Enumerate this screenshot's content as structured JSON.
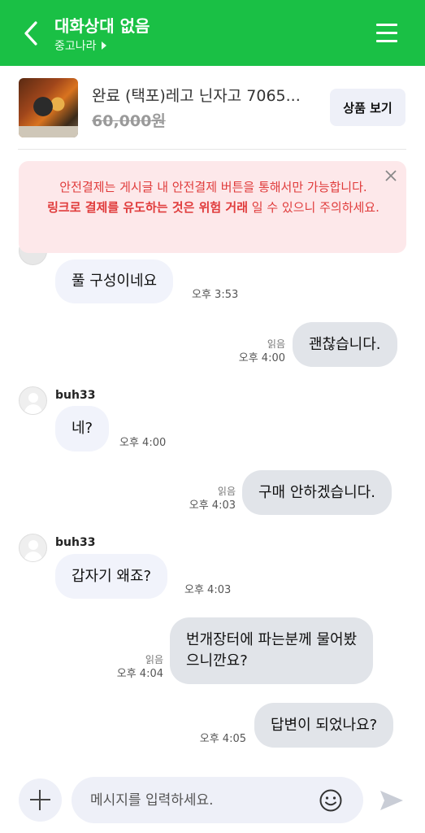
{
  "header": {
    "title": "대화상대 없음",
    "subtitle": "중고나라",
    "bg_color": "#1ac045"
  },
  "product": {
    "title": "완료 (택포)레고 닌자고 7065...",
    "price": "60,000원",
    "view_button": "상품 보기"
  },
  "warning": {
    "line1": "안전결제는 게시글 내 안전결제 버튼을 통해서만 가능합니다.",
    "bold": "링크로 결제를 유도하는 것은 위험 거래",
    "tail": " 일 수 있으니 주의하세요.",
    "color": "#e03b3b"
  },
  "messages": [
    {
      "side": "in",
      "text": "풀 구성이네요",
      "time": "오후 3:53"
    },
    {
      "side": "out",
      "text": "괜찮습니다.",
      "read": "읽음",
      "time": "오후 4:00"
    },
    {
      "side": "in",
      "sender": "buh33",
      "text": "네?",
      "time": "오후 4:00"
    },
    {
      "side": "out",
      "text": "구매 안하겠습니다.",
      "read": "읽음",
      "time": "오후 4:03"
    },
    {
      "side": "in",
      "sender": "buh33",
      "text": "갑자기 왜죠?",
      "time": "오후 4:03"
    },
    {
      "side": "out",
      "text_line1": "번개장터에 파는분께 물어봤",
      "text_line2": "으니깐요?",
      "read": "읽음",
      "time": "오후 4:04"
    },
    {
      "side": "out",
      "text": "답변이 되었나요?",
      "time": "오후 4:05"
    }
  ],
  "input": {
    "placeholder": "메시지를 입력하세요."
  }
}
